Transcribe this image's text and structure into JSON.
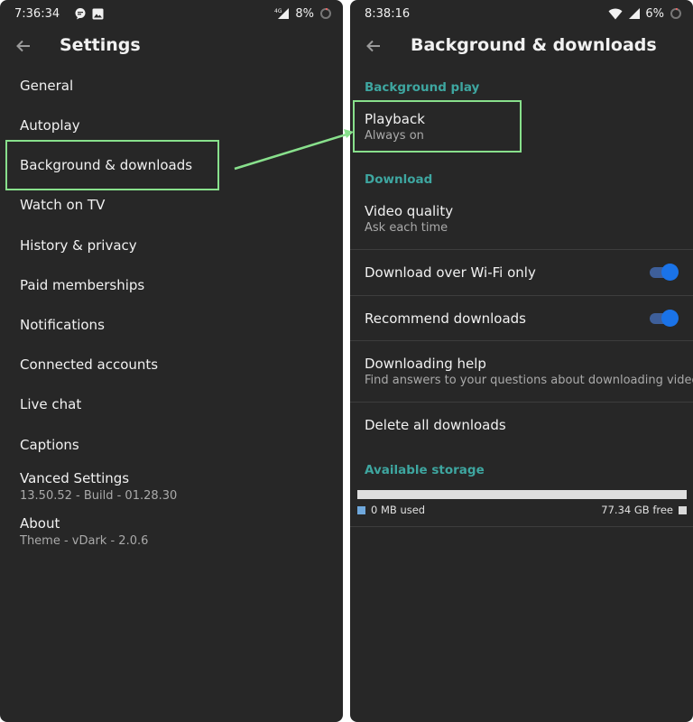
{
  "left_phone": {
    "status_bar": {
      "time": "7:36:34",
      "network": "4G",
      "battery": "8%"
    },
    "app_bar": {
      "title": "Settings"
    },
    "menu": [
      {
        "label": "General"
      },
      {
        "label": "Autoplay"
      },
      {
        "label": "Background & downloads"
      },
      {
        "label": "Watch on TV"
      },
      {
        "label": "History & privacy"
      },
      {
        "label": "Paid memberships"
      },
      {
        "label": "Notifications"
      },
      {
        "label": "Connected accounts"
      },
      {
        "label": "Live chat"
      },
      {
        "label": "Captions"
      },
      {
        "label": "Vanced Settings",
        "sublabel": "13.50.52 - Build - 01.28.30"
      },
      {
        "label": "About",
        "sublabel": "Theme - vDark - 2.0.6"
      }
    ]
  },
  "right_phone": {
    "status_bar": {
      "time": "8:38:16",
      "battery": "6%"
    },
    "app_bar": {
      "title": "Background & downloads"
    },
    "sections": {
      "background_play": "Background play",
      "download": "Download",
      "available_storage": "Available storage"
    },
    "playback": {
      "title": "Playback",
      "subtitle": "Always on"
    },
    "video_quality": {
      "title": "Video quality",
      "subtitle": "Ask each time"
    },
    "download_wifi_only": {
      "title": "Download over Wi-Fi only",
      "enabled": true
    },
    "recommend_downloads": {
      "title": "Recommend downloads",
      "enabled": true
    },
    "downloading_help": {
      "title": "Downloading help",
      "subtitle": "Find answers to your questions about downloading videos"
    },
    "delete_all_downloads": {
      "title": "Delete all downloads"
    },
    "storage": {
      "used_label": "0 MB used",
      "free_label": "77.34 GB free",
      "used_fraction": 0
    }
  },
  "colors": {
    "background": "#272727",
    "accent_teal": "#3ea6a0",
    "toggle_blue": "#1a73e8",
    "highlight_green": "#88e08c"
  }
}
